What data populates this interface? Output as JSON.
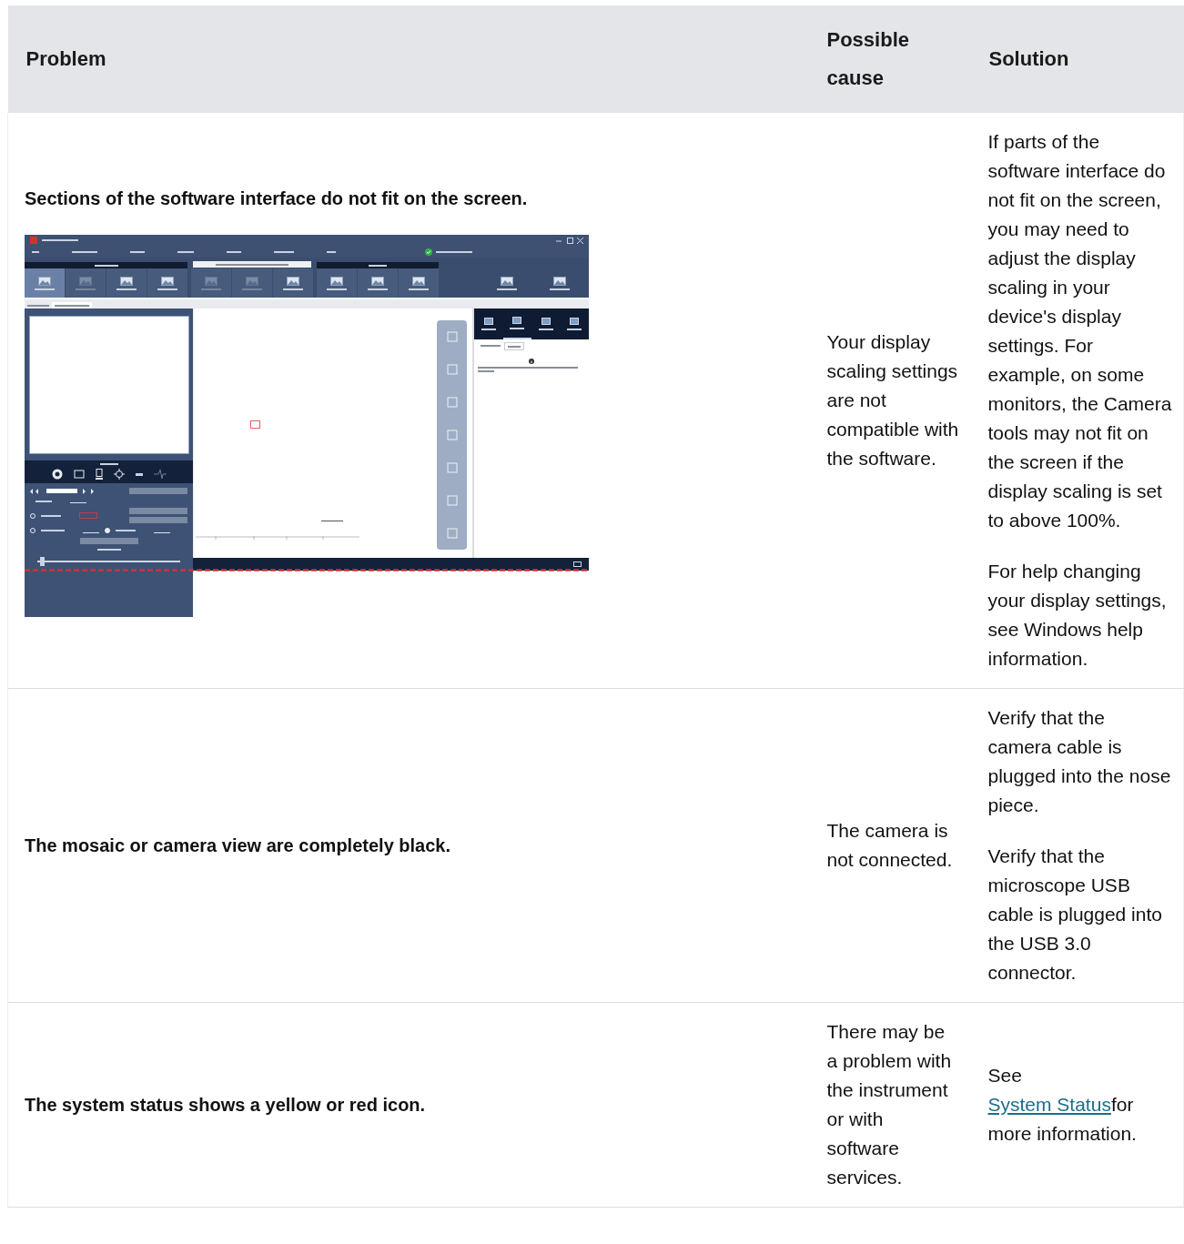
{
  "table": {
    "columns": [
      "Problem",
      "Possible cause",
      "Solution"
    ],
    "rows": [
      {
        "kind": "screenshot",
        "problem": "Sections of the software interface do not fit on the screen.",
        "cause": "Your display scaling settings are not compatible with the software.",
        "solution": [
          {
            "text": "If parts of the software interface do not fit on the screen, you may need to adjust the display scaling in your device's display settings. For example, on some monitors, the Camera tools may not fit on the screen if the display scaling is set to above 100%."
          },
          {
            "text": "For help changing your display settings, see Windows help information."
          }
        ]
      },
      {
        "kind": "text",
        "problem": "The mosaic or camera view are completely black.",
        "cause": "The camera is not connected.",
        "solution": [
          {
            "text": "Verify that the camera cable is plugged into the nose piece."
          },
          {
            "text": "Verify that the microscope USB cable is plugged into the USB 3.0 connector."
          }
        ]
      },
      {
        "kind": "text",
        "problem": "The system status shows a yellow or red icon.",
        "cause": "There may be a problem with the instrument or with software services.",
        "solution": [
          {
            "text": "See ",
            "link": "System Status",
            "after": "for more information."
          }
        ]
      }
    ]
  }
}
